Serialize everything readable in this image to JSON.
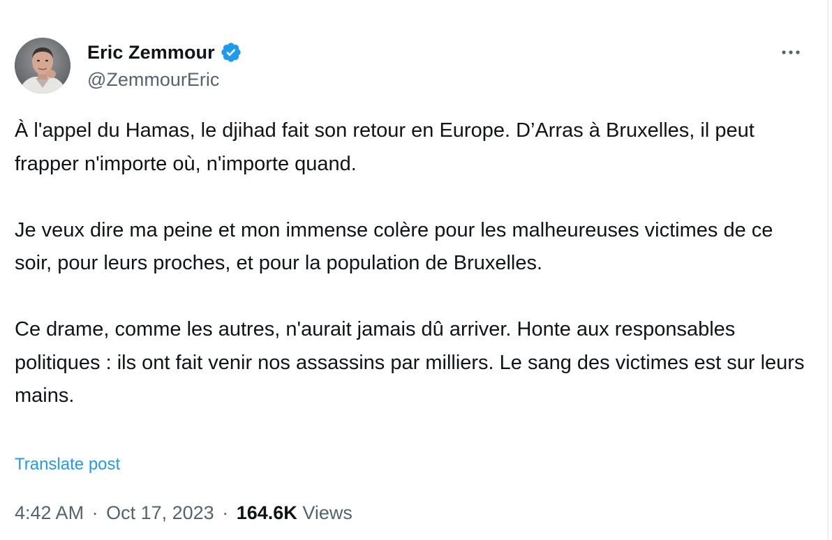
{
  "author": {
    "display_name": "Eric Zemmour",
    "handle": "@ZemmourEric",
    "verified": true
  },
  "tweet": {
    "paragraphs": [
      "À l'appel du Hamas, le djihad fait son retour en Europe. D’Arras à Bruxelles, il peut frapper n'importe où, n'importe quand.",
      "Je veux dire ma peine et mon immense colère pour les malheureuses victimes de ce soir, pour leurs proches, et pour la population de Bruxelles.",
      "Ce drame, comme les autres, n'aurait jamais dû arriver. Honte aux responsables politiques : ils ont fait venir nos assassins par milliers. Le sang des victimes est sur leurs mains."
    ],
    "translate_label": "Translate post"
  },
  "meta": {
    "time": "4:42 AM",
    "separator": "·",
    "date": "Oct 17, 2023",
    "views_count": "164.6K",
    "views_label": "Views"
  },
  "icons": {
    "verified": "verified-badge-icon",
    "more": "more-horizontal-icon",
    "avatar": "avatar-photo"
  },
  "colors": {
    "text_primary": "#0f1419",
    "text_secondary": "#536471",
    "accent": "#1d9bf0"
  }
}
